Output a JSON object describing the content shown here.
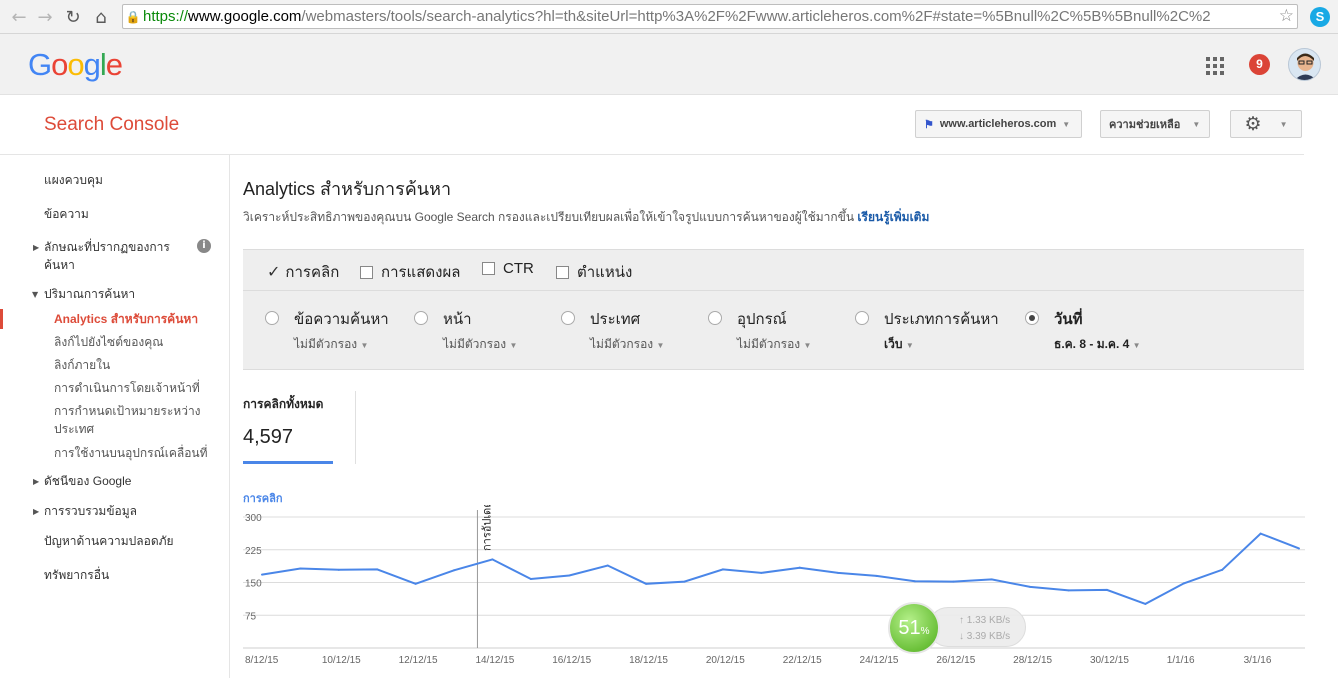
{
  "browser": {
    "url_https": "https://",
    "url_host": "www.google.com",
    "url_rest": "/webmasters/tools/search-analytics?hl=th&siteUrl=http%3A%2F%2Fwww.articleheros.com%2F#state=%5Bnull%2C%5B%5Bnull%2C%2"
  },
  "google_bar": {
    "logo": "Google",
    "notification_count": "9"
  },
  "header": {
    "brand": "Search Console",
    "site_selector": "www.articleheros.com",
    "help_button": "ความช่วยเหลือ"
  },
  "sidebar": {
    "dashboard": "แผงควบคุม",
    "messages": "ข้อความ",
    "search_appearance": "ลักษณะที่ปรากฏของการค้นหา",
    "search_traffic": "ปริมาณการค้นหา",
    "sub": {
      "analytics": "Analytics สำหรับการค้นหา",
      "links_to_site": "ลิงก์ไปยังไซต์ของคุณ",
      "internal_links": "ลิงก์ภายใน",
      "manual_actions": "การดำเนินการโดยเจ้าหน้าที่",
      "intl_targeting": "การกำหนดเป้าหมายระหว่างประเทศ",
      "mobile_usability": "การใช้งานบนอุปกรณ์เคลื่อนที่"
    },
    "google_index": "ดัชนีของ Google",
    "crawl": "การรวบรวมข้อมูล",
    "security_issues": "ปัญหาด้านความปลอดภัย",
    "other_resources": "ทรัพยากรอื่น"
  },
  "main": {
    "title": "Analytics สำหรับการค้นหา",
    "description": "วิเคราะห์ประสิทธิภาพของคุณบน Google Search กรองและเปรียบเทียบผลเพื่อให้เข้าใจรูปแบบการค้นหาของผู้ใช้มากขึ้น",
    "learn_more": "เรียนรู้เพิ่มเติม",
    "metrics": [
      {
        "label": "การคลิก",
        "checked": true
      },
      {
        "label": "การแสดงผล",
        "checked": false
      },
      {
        "label": "CTR",
        "checked": false
      },
      {
        "label": "ตำแหน่ง",
        "checked": false
      }
    ],
    "dimensions": [
      {
        "label": "ข้อความค้นหา",
        "filter": "ไม่มีตัวกรอง",
        "selected": false
      },
      {
        "label": "หน้า",
        "filter": "ไม่มีตัวกรอง",
        "selected": false
      },
      {
        "label": "ประเทศ",
        "filter": "ไม่มีตัวกรอง",
        "selected": false
      },
      {
        "label": "อุปกรณ์",
        "filter": "ไม่มีตัวกรอง",
        "selected": false
      },
      {
        "label": "ประเภทการค้นหา",
        "filter": "เว็บ",
        "selected": false
      },
      {
        "label": "วันที่",
        "filter": "ธ.ค. 8 - ม.ค. 4",
        "selected": true
      }
    ],
    "total_clicks_label": "การคลิกทั้งหมด",
    "total_clicks_value": "4,597"
  },
  "chart_data": {
    "type": "line",
    "title": "",
    "ylabel": "การคลิก",
    "ylim": [
      0,
      300
    ],
    "yticks": [
      300,
      225,
      150,
      75
    ],
    "x_tick_labels": [
      "8/12/15",
      "10/12/15",
      "12/12/15",
      "14/12/15",
      "16/12/15",
      "18/12/15",
      "20/12/15",
      "22/12/15",
      "24/12/15",
      "26/12/15",
      "28/12/15",
      "30/12/15",
      "1/1/16",
      "3/1/16"
    ],
    "annotation": {
      "label": "การอัปเดต",
      "x": "14/12/15"
    },
    "series": [
      {
        "color": "#4a86e8",
        "x": [
          "8/12/15",
          "9/12/15",
          "10/12/15",
          "11/12/15",
          "12/12/15",
          "13/12/15",
          "14/12/15",
          "15/12/15",
          "16/12/15",
          "17/12/15",
          "18/12/15",
          "19/12/15",
          "20/12/15",
          "21/12/15",
          "22/12/15",
          "23/12/15",
          "24/12/15",
          "25/12/15",
          "26/12/15",
          "27/12/15",
          "28/12/15",
          "29/12/15",
          "30/12/15",
          "31/12/15",
          "1/1/16",
          "2/1/16",
          "3/1/16",
          "4/1/16"
        ],
        "values": [
          168,
          182,
          179,
          180,
          147,
          178,
          203,
          158,
          166,
          189,
          147,
          152,
          180,
          172,
          184,
          172,
          165,
          153,
          152,
          157,
          140,
          132,
          133,
          101,
          148,
          179,
          262,
          228
        ]
      }
    ]
  },
  "speed_widget": {
    "percent": "51",
    "percent_sign": "%",
    "up": "1.33 KB/s",
    "down": "3.39 KB/s"
  }
}
